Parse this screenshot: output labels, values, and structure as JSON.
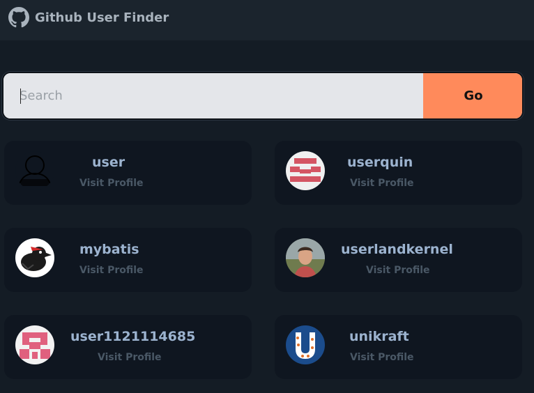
{
  "header": {
    "title": "Github User Finder",
    "logo_icon": "github-icon"
  },
  "search": {
    "placeholder": "Search",
    "value": "",
    "button_label": "Go",
    "button_color": "#ff8a5b"
  },
  "results": [
    {
      "username": "user",
      "link_label": "Visit Profile",
      "avatar": "default-silhouette"
    },
    {
      "username": "userquin",
      "link_label": "Visit Profile",
      "avatar": "red-identicon"
    },
    {
      "username": "mybatis",
      "link_label": "Visit Profile",
      "avatar": "bird-logo"
    },
    {
      "username": "userlandkernel",
      "link_label": "Visit Profile",
      "avatar": "person-photo"
    },
    {
      "username": "user1121114685",
      "link_label": "Visit Profile",
      "avatar": "pink-identicon"
    },
    {
      "username": "unikraft",
      "link_label": "Visit Profile",
      "avatar": "unikraft-logo"
    }
  ]
}
